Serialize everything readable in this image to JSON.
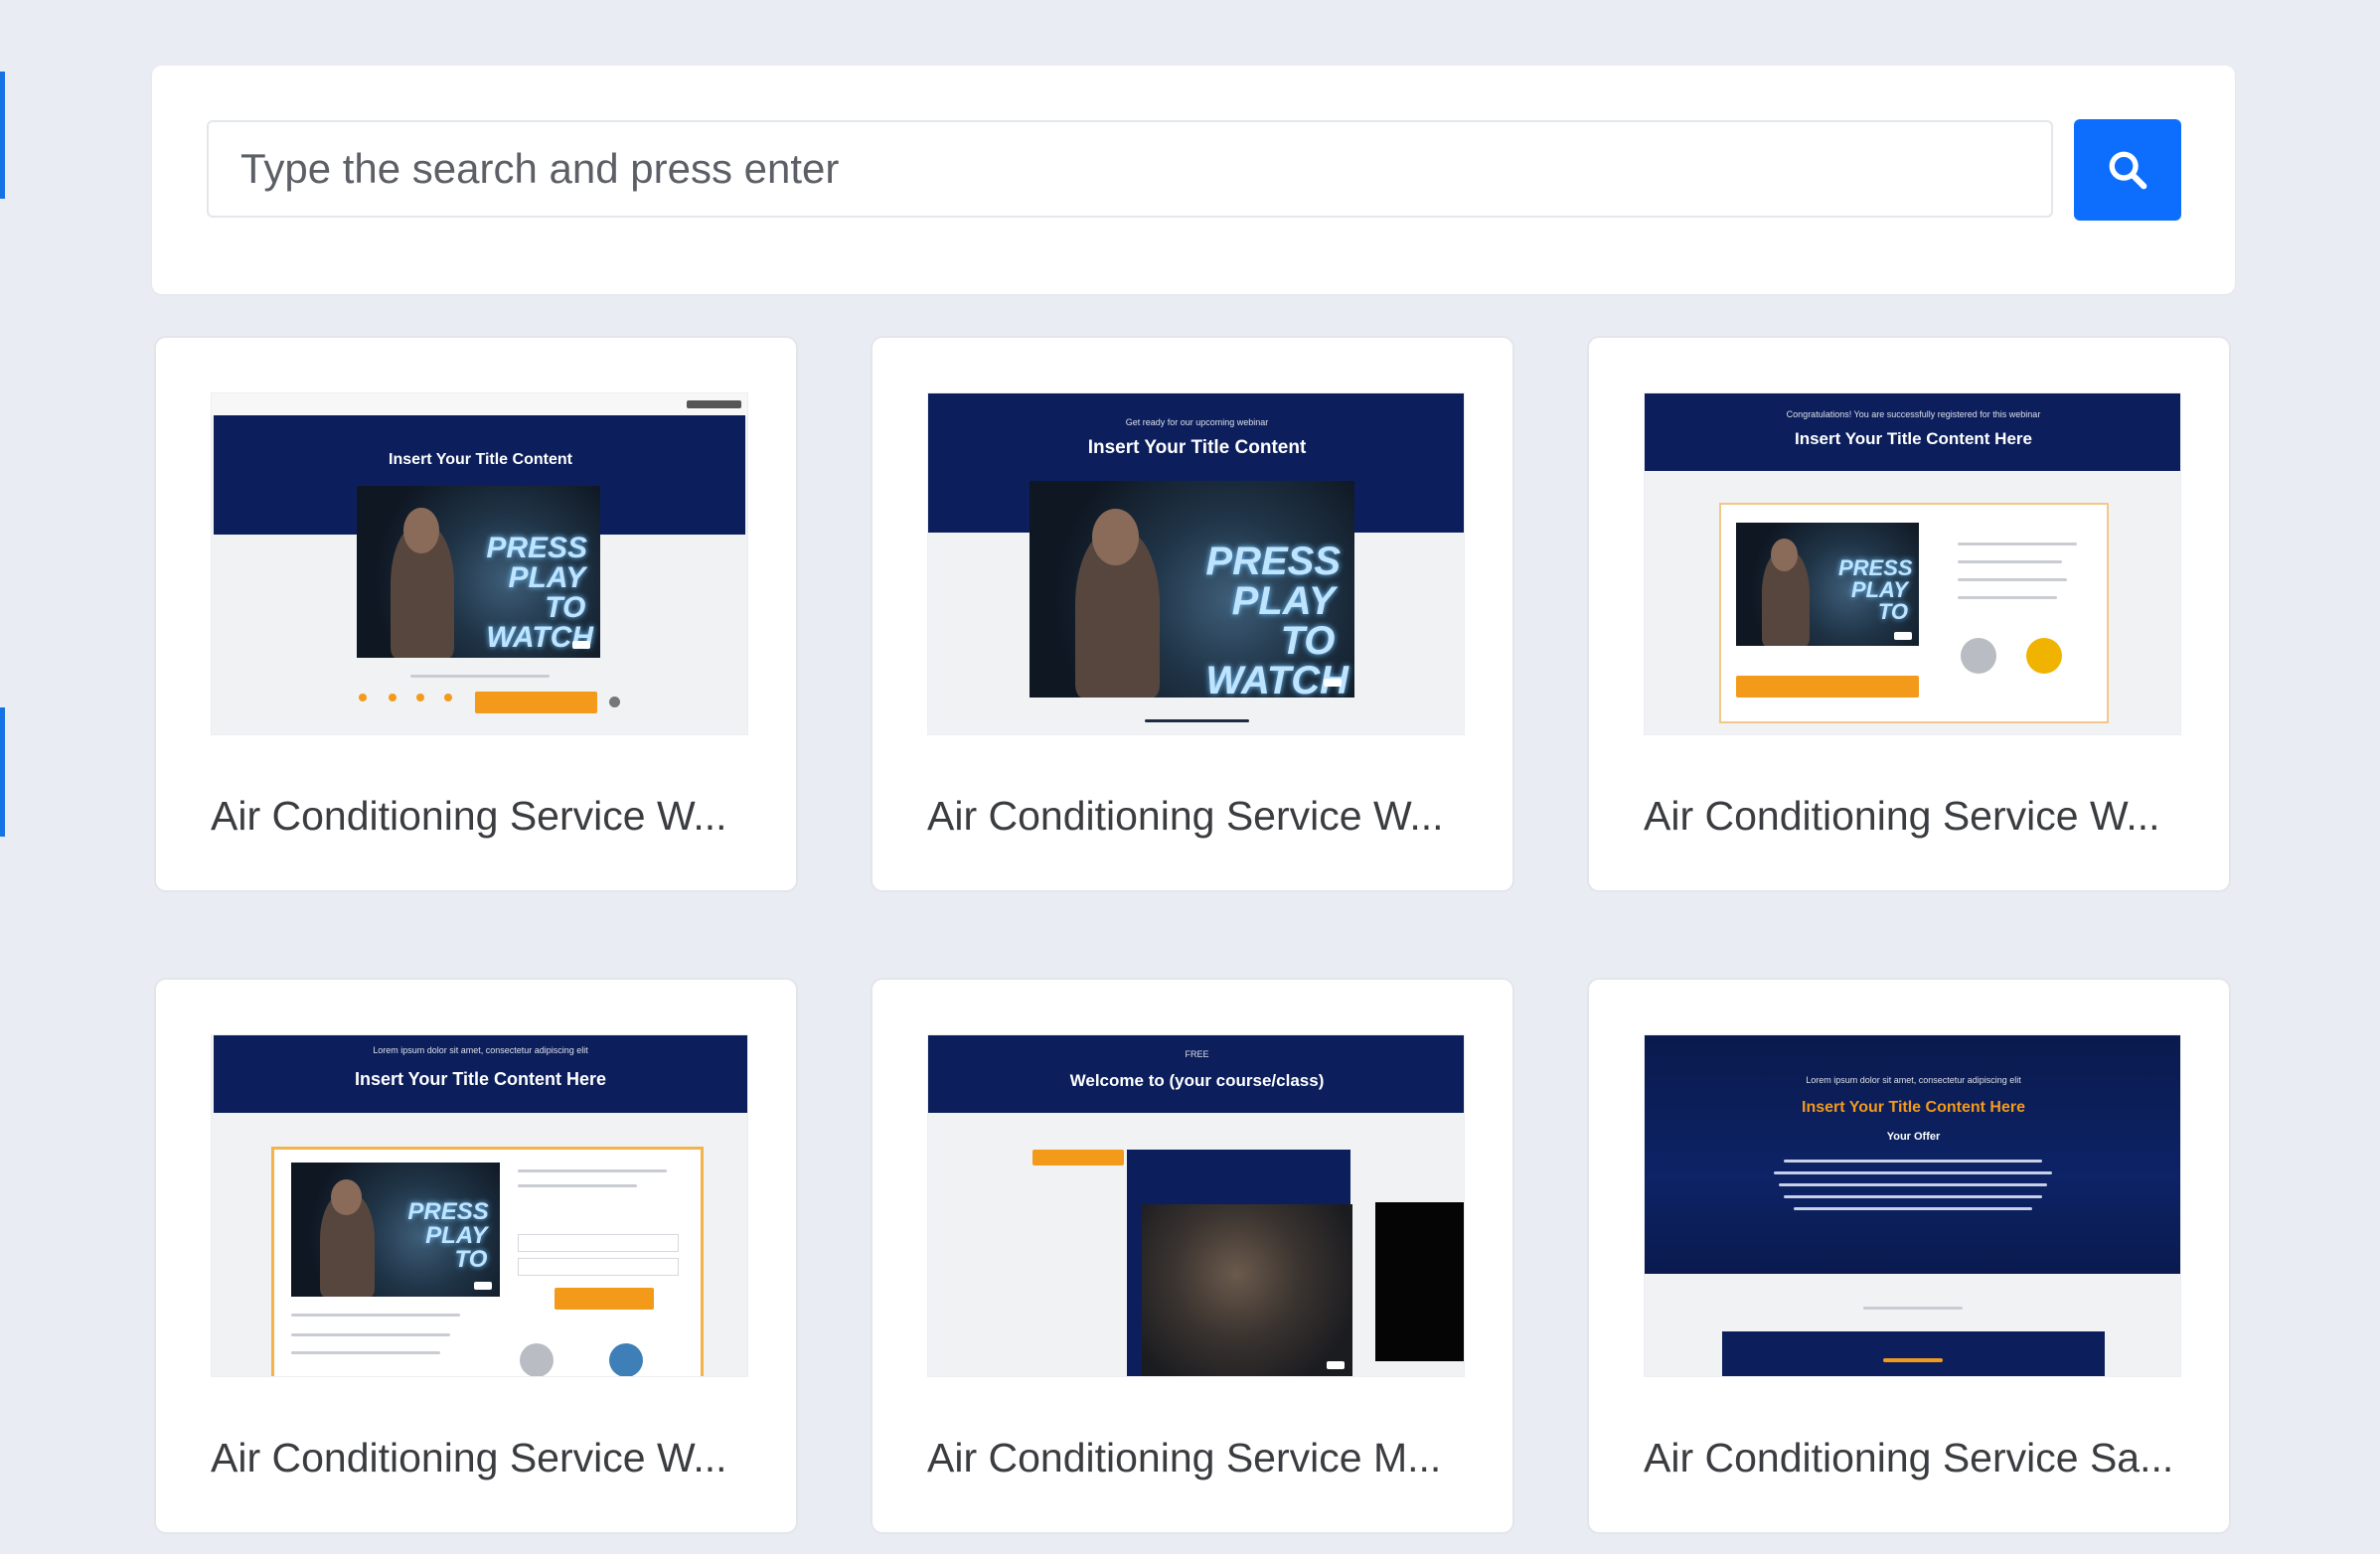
{
  "search": {
    "placeholder": "Type the search and press enter",
    "button_icon": "search-icon"
  },
  "colors": {
    "page_bg": "#e9edf3",
    "accent": "#0d6efd",
    "navy": "#0c1f5c",
    "orange": "#f39a1b"
  },
  "cards": [
    {
      "title": "Air Conditioning Service W...",
      "thumb": {
        "headline": "Insert Your Title Content",
        "video_text": "PRESS PLAY TO WATCH"
      }
    },
    {
      "title": "Air Conditioning Service W...",
      "thumb": {
        "headline": "Insert Your Title Content",
        "video_text": "PRESS PLAY TO WATCH"
      }
    },
    {
      "title": "Air Conditioning Service W...",
      "thumb": {
        "headline": "Insert Your Title Content Here",
        "video_text": "PRESS PLAY TO"
      }
    },
    {
      "title": "Air Conditioning Service W...",
      "thumb": {
        "headline": "Insert Your Title Content Here",
        "video_text": "PRESS PLAY TO"
      }
    },
    {
      "title": "Air Conditioning Service M...",
      "thumb": {
        "headline": "Welcome to (your course/class)"
      }
    },
    {
      "title": "Air Conditioning Service Sa...",
      "thumb": {
        "headline": "Insert Your Title Content Here",
        "subheadline": "Your Offer"
      }
    }
  ]
}
